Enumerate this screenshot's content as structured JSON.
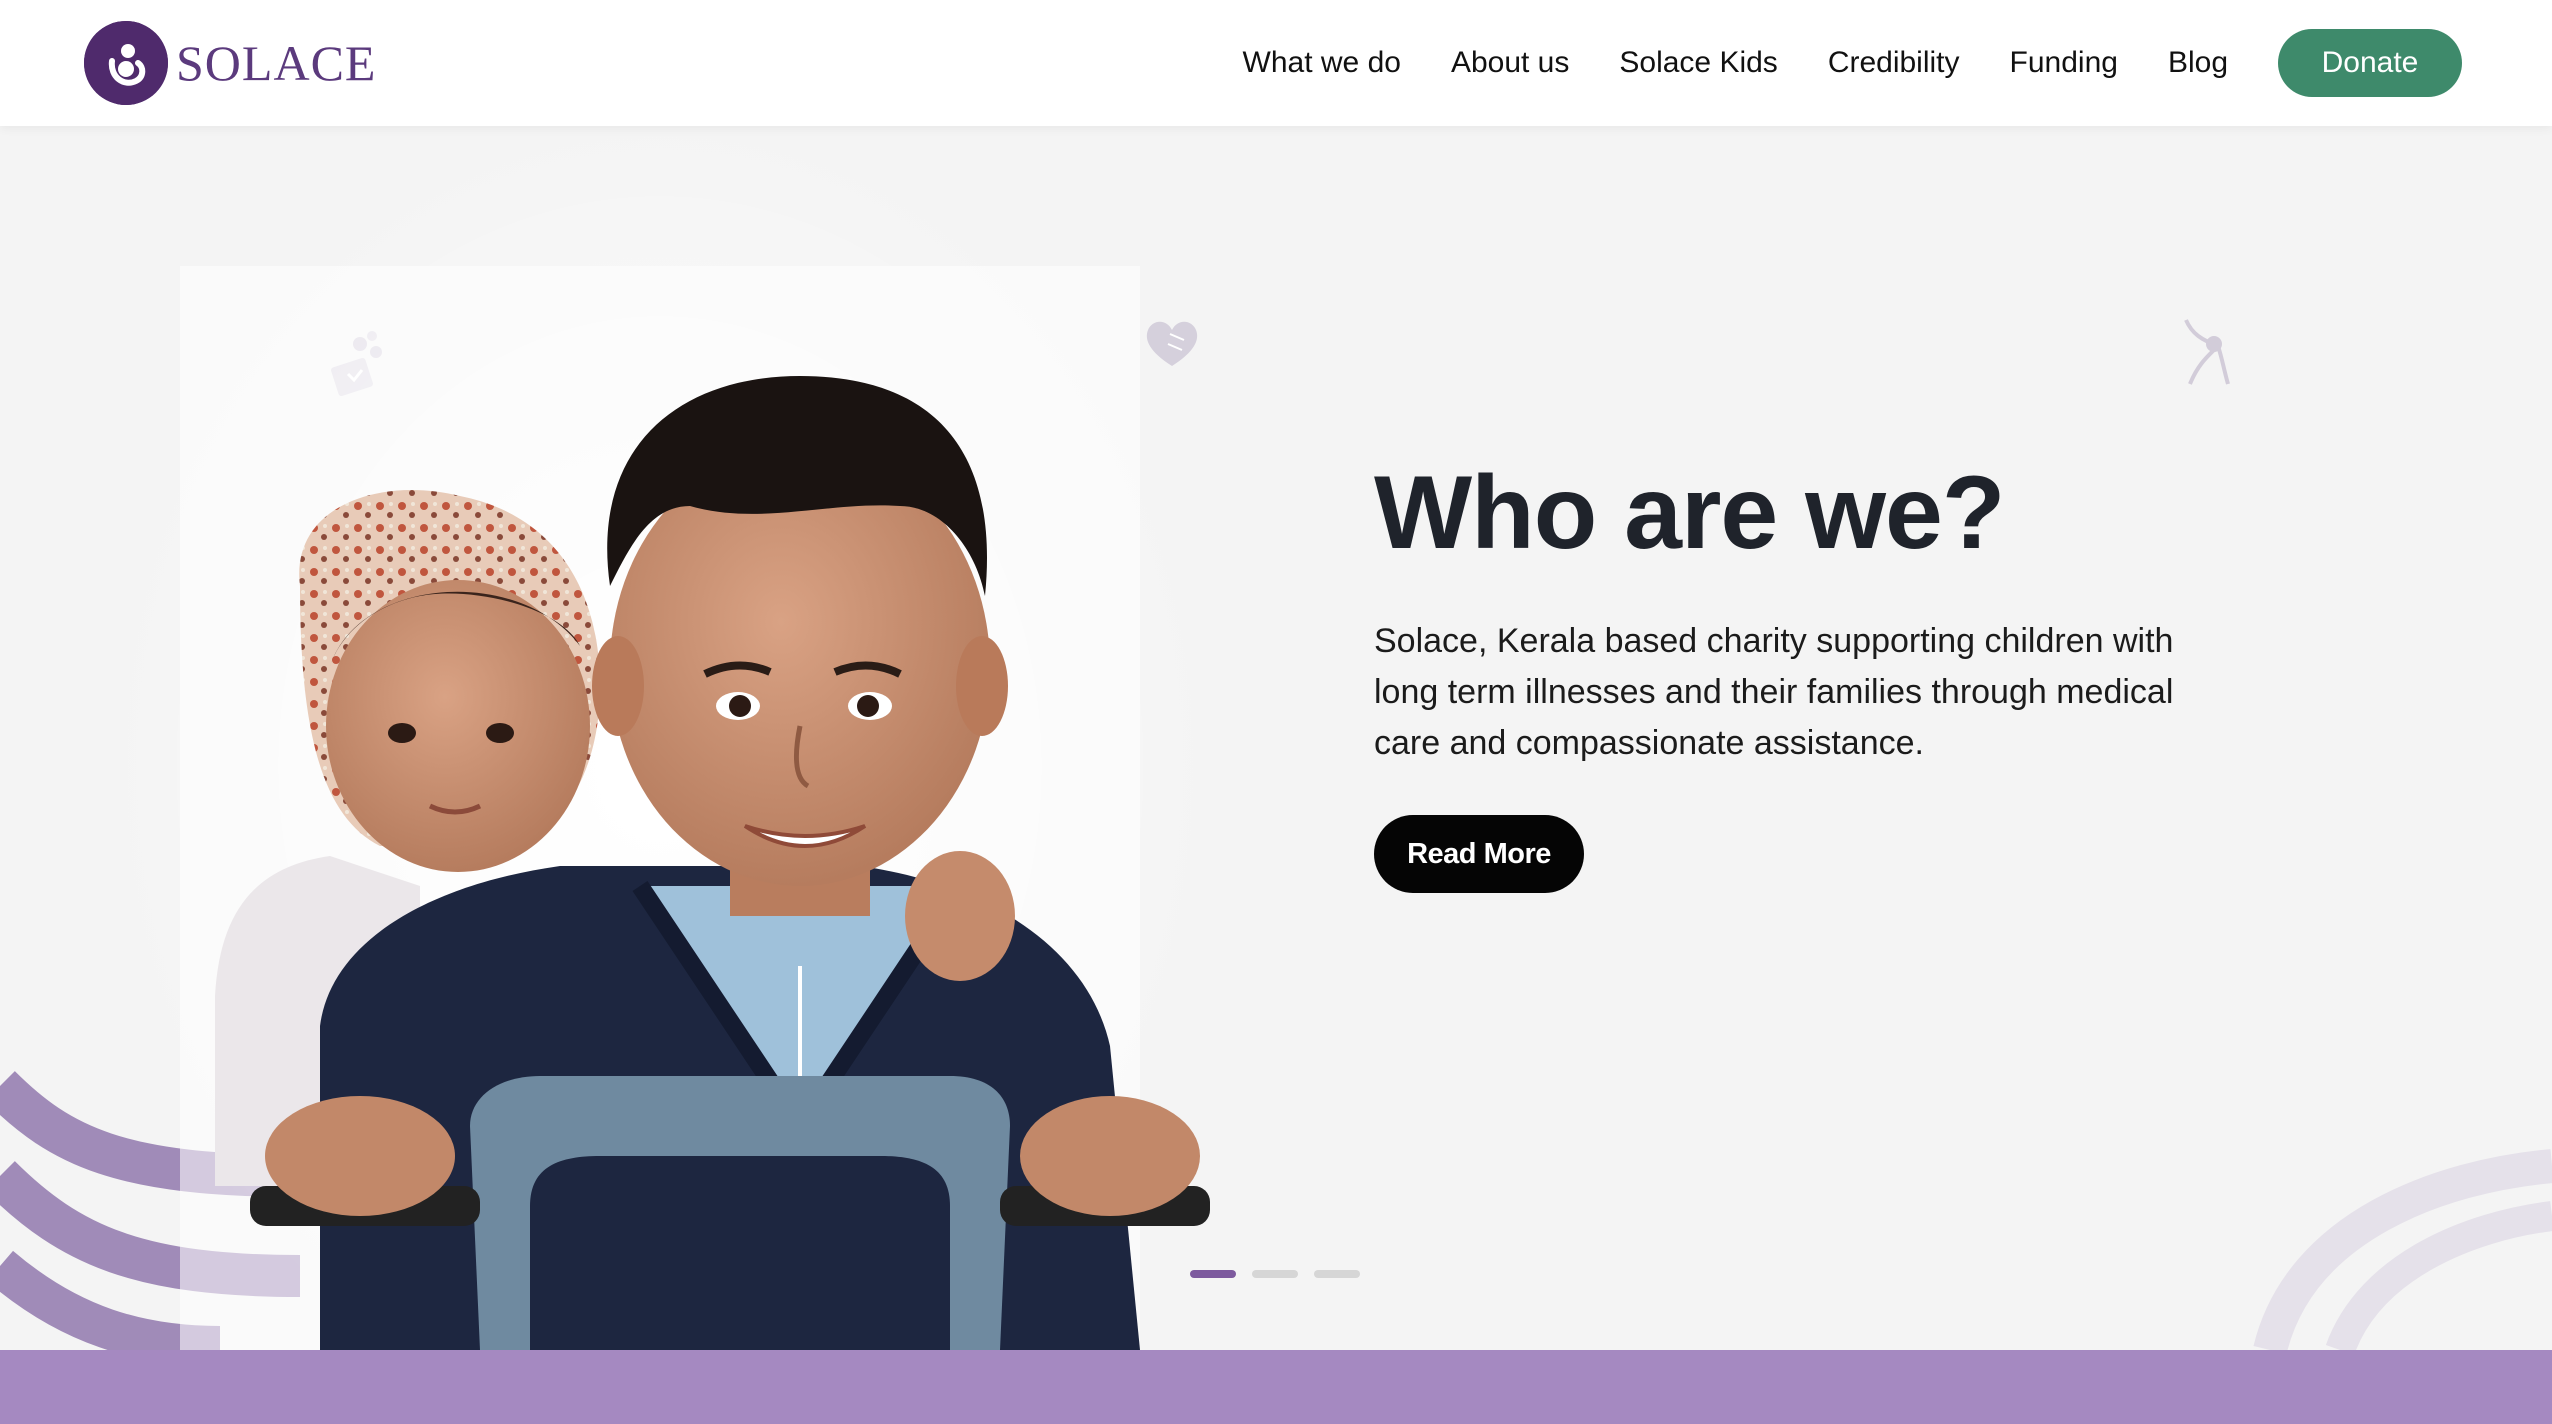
{
  "brand": {
    "name": "SOLACE",
    "logo_color": "#4f2a6c",
    "text_color": "#5b3a7d"
  },
  "nav": {
    "items": [
      {
        "label": "What we do"
      },
      {
        "label": "About us"
      },
      {
        "label": "Solace Kids"
      },
      {
        "label": "Credibility"
      },
      {
        "label": "Funding"
      },
      {
        "label": "Blog"
      }
    ],
    "donate_label": "Donate",
    "donate_color": "#3e8a6b"
  },
  "hero": {
    "title": "Who are we?",
    "description": "Solace, Kerala based charity supporting children with long term illnesses and their families through medical care and compassionate assistance.",
    "cta_label": "Read More",
    "photo_icon": "children-photo",
    "decorative_icons": [
      "gift-box-icon",
      "heart-icon",
      "ribbon-icon"
    ],
    "slider": {
      "slides": 3,
      "active": 1
    }
  },
  "colors": {
    "accent_purple": "#a589c1",
    "dark": "#1f232b",
    "background": "#f4f4f4"
  }
}
